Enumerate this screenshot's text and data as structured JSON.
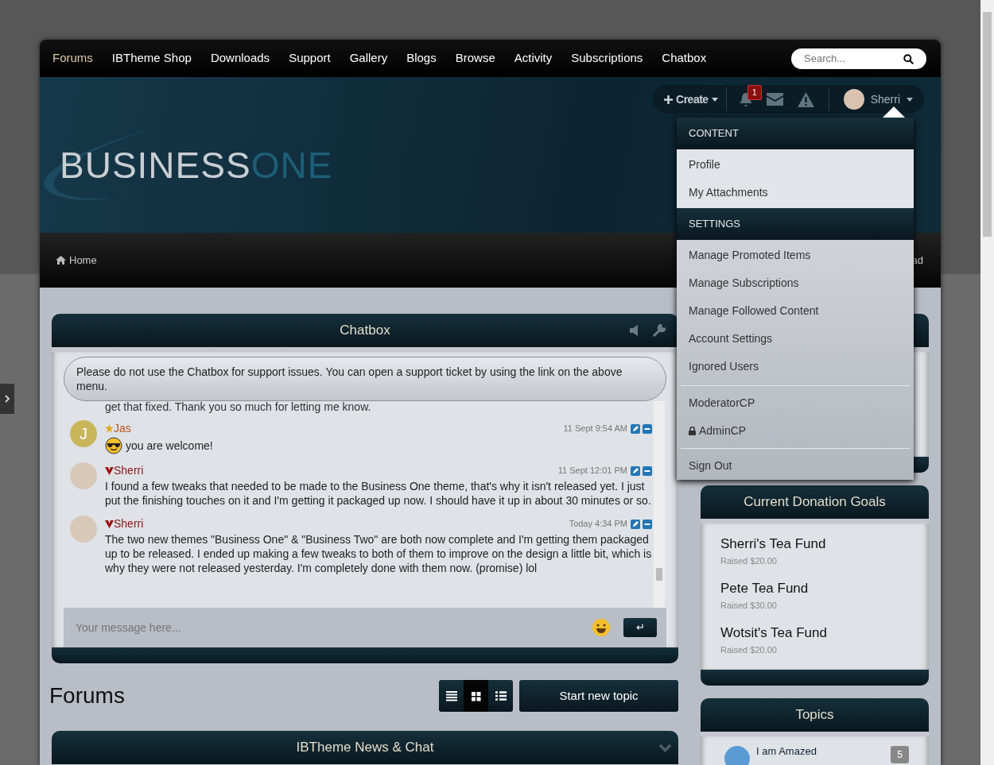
{
  "nav": {
    "items": [
      {
        "label": "Forums",
        "selected": true
      },
      {
        "label": "IBTheme Shop",
        "selected": false
      },
      {
        "label": "Downloads",
        "selected": false
      },
      {
        "label": "Support",
        "selected": false
      },
      {
        "label": "Gallery",
        "selected": false
      },
      {
        "label": "Blogs",
        "selected": false
      },
      {
        "label": "Browse",
        "selected": false
      },
      {
        "label": "Activity",
        "selected": false
      },
      {
        "label": "Subscriptions",
        "selected": false
      },
      {
        "label": "Chatbox",
        "selected": false
      }
    ],
    "search": {
      "placeholder": "Search..."
    }
  },
  "userbar": {
    "create": "Create",
    "notifications_count": "1",
    "username": "Sherri"
  },
  "logo": {
    "part1": "BUSINESS",
    "part2": "ONE"
  },
  "breadcrumb": {
    "home": "Home",
    "right": "ad"
  },
  "user_menu": {
    "sections": [
      {
        "heading": "CONTENT",
        "items": [
          {
            "label": "Profile"
          },
          {
            "label": "My Attachments"
          }
        ]
      },
      {
        "heading": "SETTINGS",
        "items": [
          {
            "label": "Manage Promoted Items"
          },
          {
            "label": "Manage Subscriptions"
          },
          {
            "label": "Manage Followed Content"
          },
          {
            "label": "Account Settings"
          },
          {
            "label": "Ignored Users"
          }
        ]
      }
    ],
    "extra_groups": [
      [
        {
          "label": "ModeratorCP",
          "locked": false
        },
        {
          "label": "AdminCP",
          "locked": true
        }
      ],
      [
        {
          "label": "Sign Out",
          "locked": false
        }
      ]
    ]
  },
  "chatbox": {
    "title": "Chatbox",
    "notice": "Please do not use the Chatbox for support issues. You can open a support ticket by using the link on the above menu.",
    "partial_line": "get that fixed. Thank you so much for letting me know.",
    "messages": [
      {
        "name": "Jas",
        "color": "#b5561f",
        "kind": "star",
        "avatar": {
          "kind": "letter",
          "letter": "J"
        },
        "time": "11 Sept 9:54 AM",
        "emoji_prefix": true,
        "text": "you are welcome!"
      },
      {
        "name": "Sherri",
        "color": "#8b1414",
        "kind": "moderator",
        "avatar": {
          "kind": "photo"
        },
        "time": "11 Sept 12:01 PM",
        "emoji_prefix": false,
        "text": "I found a few tweaks that needed to be made to the Business One theme, that's why it isn't released yet. I just put the finishing touches on it and I'm getting it packaged up now. I should have it up in about 30 minutes or so."
      },
      {
        "name": "Sherri",
        "color": "#8b1414",
        "kind": "moderator",
        "avatar": {
          "kind": "photo"
        },
        "time": "Today 4:34 PM",
        "emoji_prefix": false,
        "text": "The two new themes \"Business One\" & \"Business Two\" are both now complete and I'm getting them packaged up to be released. I ended up making a few tweaks to both of them to improve on the design a little bit, which is why they were not released yesterday. I'm completely done with them now. (promise) lol"
      }
    ],
    "input": {
      "placeholder": "Your message here..."
    },
    "send": "↵"
  },
  "forums": {
    "title": "Forums",
    "view_buttons": [
      {
        "kind": "list",
        "selected": false
      },
      {
        "kind": "grid",
        "selected": true
      },
      {
        "kind": "table",
        "selected": false
      }
    ],
    "new_topic": "Start new topic",
    "category": "IBTheme News & Chat"
  },
  "donations": {
    "title": "Current Donation Goals",
    "goals": [
      {
        "name": "Sherri's Tea Fund",
        "raised": "Raised $20.00"
      },
      {
        "name": "Pete Tea Fund",
        "raised": "Raised $30.00"
      },
      {
        "name": "Wotsit's Tea Fund",
        "raised": "Raised $20.00"
      }
    ]
  },
  "topics": {
    "title": "Topics",
    "items": [
      {
        "title": "I am Amazed",
        "count": "5"
      }
    ]
  }
}
